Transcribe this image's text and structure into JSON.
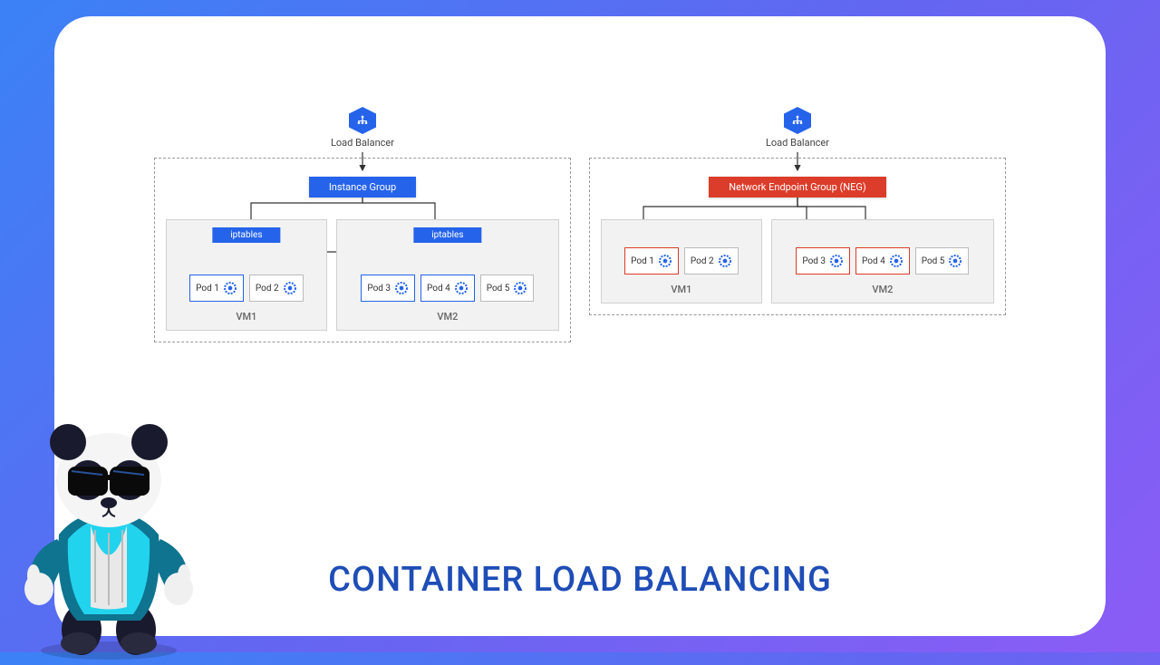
{
  "title": "CONTAINER LOAD BALANCING",
  "left": {
    "lb_label": "Load Balancer",
    "group_label": "Instance Group",
    "group_color": "blue",
    "vms": [
      {
        "label": "VM1",
        "iptables": "iptables",
        "pods": [
          {
            "label": "Pod 1",
            "highlight": "blue"
          },
          {
            "label": "Pod 2",
            "highlight": "none"
          }
        ]
      },
      {
        "label": "VM2",
        "iptables": "iptables",
        "pods": [
          {
            "label": "Pod 3",
            "highlight": "blue"
          },
          {
            "label": "Pod 4",
            "highlight": "blue"
          },
          {
            "label": "Pod 5",
            "highlight": "none"
          }
        ]
      }
    ]
  },
  "right": {
    "lb_label": "Load Balancer",
    "group_label": "Network Endpoint Group (NEG)",
    "group_color": "red",
    "vms": [
      {
        "label": "VM1",
        "pods": [
          {
            "label": "Pod 1",
            "highlight": "red"
          },
          {
            "label": "Pod 2",
            "highlight": "none"
          }
        ]
      },
      {
        "label": "VM2",
        "pods": [
          {
            "label": "Pod 3",
            "highlight": "red"
          },
          {
            "label": "Pod 4",
            "highlight": "red"
          },
          {
            "label": "Pod 5",
            "highlight": "none"
          }
        ]
      }
    ]
  }
}
